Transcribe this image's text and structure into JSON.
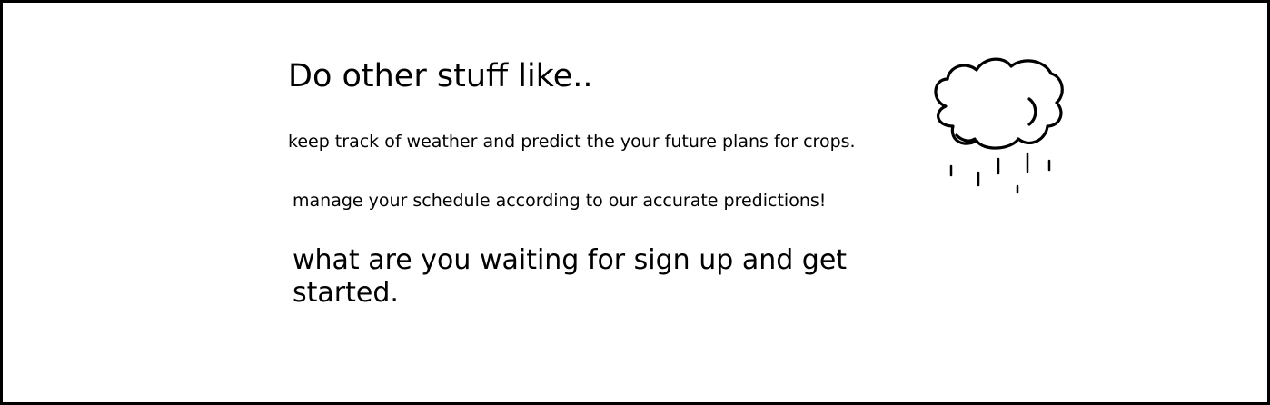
{
  "heading": "Do other stuff like..",
  "features": [
    "keep track of weather and predict the your future plans for crops.",
    "manage your schedule according to our accurate predictions!"
  ],
  "cta": "what are you waiting for sign up and get started.",
  "illustration": {
    "icon": "rain-cloud-icon",
    "stroke_color": "#000000"
  }
}
